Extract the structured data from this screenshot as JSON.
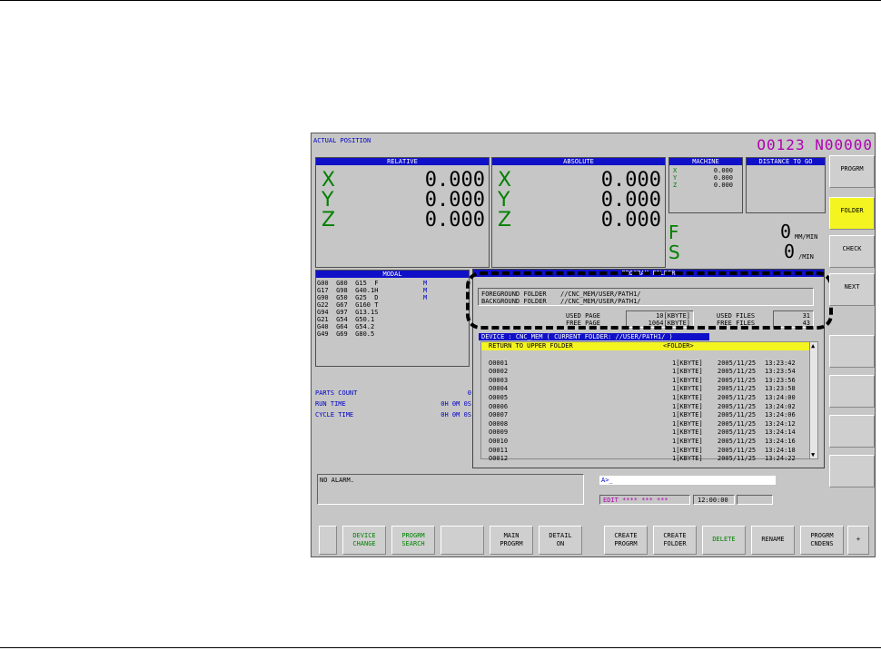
{
  "header": {
    "actual_position": "ACTUAL POSITION",
    "program_number": "O0123 N00000"
  },
  "relative": {
    "title": "RELATIVE",
    "axes": [
      {
        "axis": "X",
        "value": "0.000"
      },
      {
        "axis": "Y",
        "value": "0.000"
      },
      {
        "axis": "Z",
        "value": "0.000"
      }
    ]
  },
  "absolute": {
    "title": "ABSOLUTE",
    "axes": [
      {
        "axis": "X",
        "value": "0.000"
      },
      {
        "axis": "Y",
        "value": "0.000"
      },
      {
        "axis": "Z",
        "value": "0.000"
      }
    ]
  },
  "machine": {
    "title": "MACHINE",
    "axes": [
      {
        "axis": "X",
        "value": "0.000"
      },
      {
        "axis": "Y",
        "value": "0.000"
      },
      {
        "axis": "Z",
        "value": "0.000"
      }
    ]
  },
  "distance_to_go": {
    "title": "DISTANCE TO GO"
  },
  "feed": {
    "f_label": "F",
    "f_value": "0",
    "f_unit": "MM/MIN",
    "s_label": "S",
    "s_value": "0",
    "s_unit": "/MIN"
  },
  "modal": {
    "title": "MODAL",
    "lines": [
      "G00  G80  G15  F",
      "G17  G98  G40.1H",
      "G90  G50  G25  D",
      "G22  G67  G160 T",
      "G94  G97  G13.1S",
      "G21  G54  G50.1",
      "G40  G64  G54.2",
      "G49  G69  G80.5"
    ],
    "m_labels": [
      "M",
      "M",
      "M"
    ]
  },
  "counters": [
    {
      "label": "PARTS COUNT",
      "value": "0"
    },
    {
      "label": "RUN TIME",
      "value": "0H 0M 0S"
    },
    {
      "label": "CYCLE TIME",
      "value": "0H 0M 0S"
    }
  ],
  "program_folder": {
    "title": "PROGRAM FOLDER",
    "foreground_label": "FOREGROUND FOLDER",
    "foreground_value": "//CNC_MEM/USER/PATH1/",
    "background_label": "BACKGROUND FOLDER",
    "background_value": "//CNC_MEM/USER/PATH1/",
    "used_page_label": "USED PAGE",
    "used_page_value": "10[KBYTE]",
    "free_page_label": "FREE PAGE",
    "free_page_value": "1064[KBYTE]",
    "used_files_label": "USED FILES",
    "used_files_value": "31",
    "free_files_label": "FREE FILES",
    "free_files_value": "43"
  },
  "device_bar": "DEVICE : CNC_MEM    ( CURRENT FOLDER: //USER/PATH1/ )",
  "file_list": {
    "up_row": {
      "name": "RETURN TO UPPER FOLDER",
      "type": "<FOLDER>"
    },
    "rows": [
      {
        "name": "O0001",
        "size": "1[KBYTE]",
        "date": "2005/11/25",
        "time": "13:23:42"
      },
      {
        "name": "O0002",
        "size": "1[KBYTE]",
        "date": "2005/11/25",
        "time": "13:23:54"
      },
      {
        "name": "O0003",
        "size": "1[KBYTE]",
        "date": "2005/11/25",
        "time": "13:23:56"
      },
      {
        "name": "O0004",
        "size": "1[KBYTE]",
        "date": "2005/11/25",
        "time": "13:23:58"
      },
      {
        "name": "O0005",
        "size": "1[KBYTE]",
        "date": "2005/11/25",
        "time": "13:24:00"
      },
      {
        "name": "O0006",
        "size": "1[KBYTE]",
        "date": "2005/11/25",
        "time": "13:24:02"
      },
      {
        "name": "O0007",
        "size": "1[KBYTE]",
        "date": "2005/11/25",
        "time": "13:24:06"
      },
      {
        "name": "O0008",
        "size": "1[KBYTE]",
        "date": "2005/11/25",
        "time": "13:24:12"
      },
      {
        "name": "O0009",
        "size": "1[KBYTE]",
        "date": "2005/11/25",
        "time": "13:24:14"
      },
      {
        "name": "O0010",
        "size": "1[KBYTE]",
        "date": "2005/11/25",
        "time": "13:24:16"
      },
      {
        "name": "O0011",
        "size": "1[KBYTE]",
        "date": "2005/11/25",
        "time": "13:24:18"
      },
      {
        "name": "O0012",
        "size": "1[KBYTE]",
        "date": "2005/11/25",
        "time": "13:24:22"
      }
    ]
  },
  "alarm": "NO ALARM.",
  "input_line": "A>_",
  "status": {
    "mode": "EDIT **** *** ***",
    "clock": "12:00:00"
  },
  "right_keys": [
    "PROGRM",
    "FOLDER",
    "CHECK",
    "NEXT",
    "",
    "",
    "",
    ""
  ],
  "softkeys": [
    {
      "label": "",
      "green": false
    },
    {
      "label": "DEVICE\nCHANGE",
      "green": true
    },
    {
      "label": "PROGRM\nSEARCH",
      "green": true
    },
    {
      "label": "",
      "green": false
    },
    {
      "label": "MAIN\nPROGRM",
      "green": false
    },
    {
      "label": "DETAIL\nON",
      "green": false
    },
    {
      "label": "CREATE\nPROGRM",
      "green": false
    },
    {
      "label": "CREATE\nFOLDER",
      "green": false
    },
    {
      "label": "DELETE",
      "green": true
    },
    {
      "label": "RENAME",
      "green": false
    },
    {
      "label": "PROGRM\nCNDENS",
      "green": false
    },
    {
      "label": "+",
      "green": false
    }
  ],
  "colors": {
    "bar_blue": "#1010c8",
    "highlight_yellow": "#f4f420",
    "axis_green": "#008000",
    "title_purple": "#b000b0"
  }
}
